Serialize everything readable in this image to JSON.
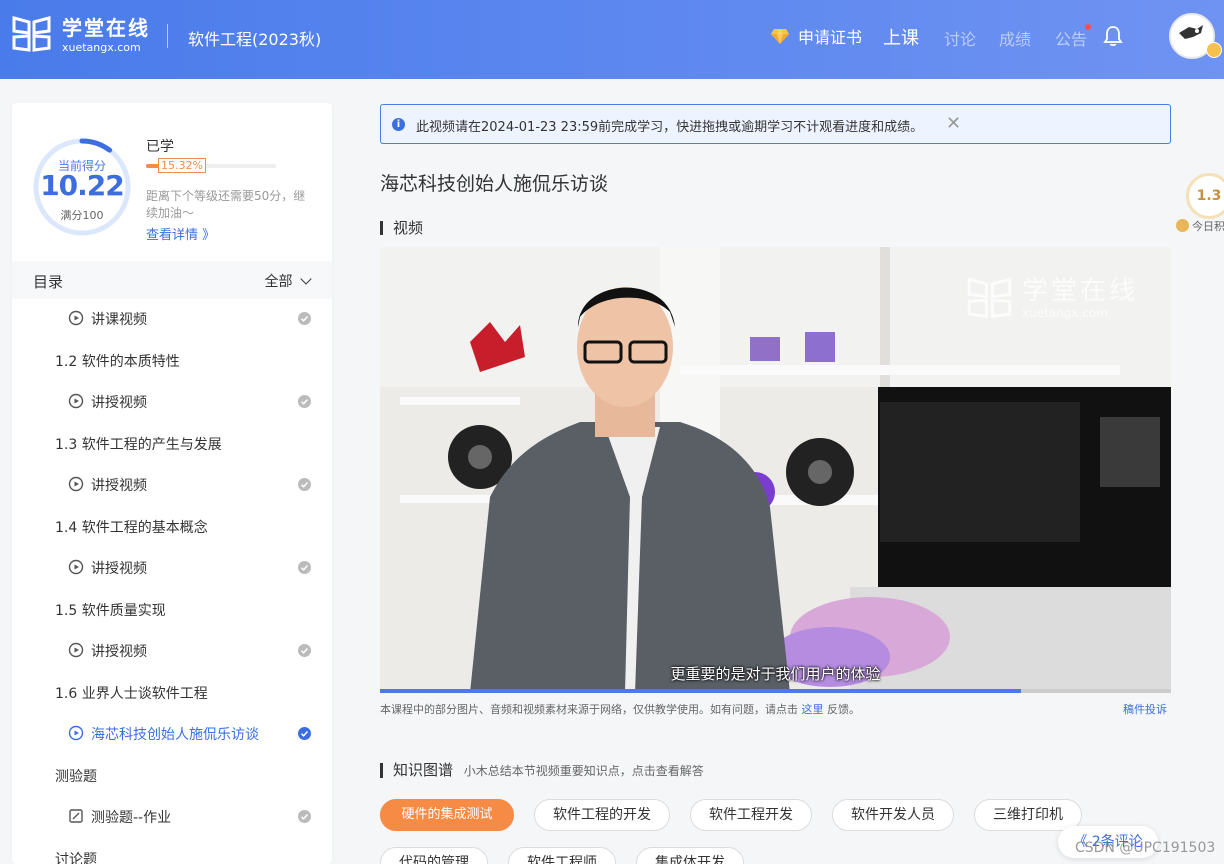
{
  "header": {
    "logo_cn": "学堂在线",
    "logo_en": "xuetangx.com",
    "course_title": "软件工程(2023秋)",
    "nav": {
      "cert": "申请证书",
      "lecture": "上课",
      "discussion": "讨论",
      "grades": "成绩",
      "announcement": "公告"
    }
  },
  "sidebar": {
    "score_label": "当前得分",
    "score_value": "10.22",
    "score_full": "满分100",
    "score_fraction": 0.1022,
    "learned_label": "已学",
    "progress_pct": "15.32%",
    "progress_fraction": 0.1532,
    "level_hint": "距离下个等级还需要50分，继续加油～",
    "detail_link": "查看详情 》",
    "toc_title": "目录",
    "toc_filter": "全部",
    "toc_items": [
      {
        "type": "lesson",
        "text": "讲课视频",
        "done": true
      },
      {
        "type": "chapter",
        "text": "1.2 软件的本质特性"
      },
      {
        "type": "lesson",
        "text": "讲授视频",
        "done": true
      },
      {
        "type": "chapter",
        "text": "1.3 软件工程的产生与发展"
      },
      {
        "type": "lesson",
        "text": "讲授视频",
        "done": true
      },
      {
        "type": "chapter",
        "text": "1.4 软件工程的基本概念"
      },
      {
        "type": "lesson",
        "text": "讲授视频",
        "done": true
      },
      {
        "type": "chapter",
        "text": "1.5 软件质量实现"
      },
      {
        "type": "lesson",
        "text": "讲授视频",
        "done": true
      },
      {
        "type": "chapter",
        "text": "1.6 业界人士谈软件工程"
      },
      {
        "type": "lesson",
        "text": "海芯科技创始人施侃乐访谈",
        "done": true,
        "current": true
      },
      {
        "type": "chapter",
        "text": "测验题"
      },
      {
        "type": "quiz",
        "text": "测验题--作业",
        "done": true
      },
      {
        "type": "chapter",
        "text": "讨论题"
      }
    ]
  },
  "main": {
    "notice": "此视频请在2024-01-23 23:59前完成学习，快进拖拽或逾期学习不计观看进度和成绩。",
    "lesson_title": "海芯科技创始人施侃乐访谈",
    "video_section": "视频",
    "video_watermark_cn": "学堂在线",
    "video_watermark_en": "xuetangx.com",
    "subtitle": "更重要的是对于我们用户的体验",
    "video_progress": 0.81,
    "copyright": "本课程中的部分图片、音频和视频素材来源于网络，仅供教学使用。如有问题，请点击",
    "copyright_link": "这里",
    "copyright_tail": "反馈。",
    "report": "稿件投诉",
    "kg_title": "知识图谱",
    "kg_sub": "小木总结本节视频重要知识点，点击查看解答",
    "tags": [
      "硬件的集成测试",
      "软件工程的开发",
      "软件工程开发",
      "软件开发人员",
      "三维打印机",
      "代码的管理",
      "软件工程师",
      "集成体开发"
    ]
  },
  "float": {
    "score": "1.3",
    "today": "今日积"
  },
  "comments": "《 2条评论",
  "watermark": "CSDN @UPC191503",
  "colors": {
    "primary": "#3d6ee0",
    "orange": "#f68b46",
    "header_start": "#4a7bea",
    "header_end": "#6f93f2"
  }
}
